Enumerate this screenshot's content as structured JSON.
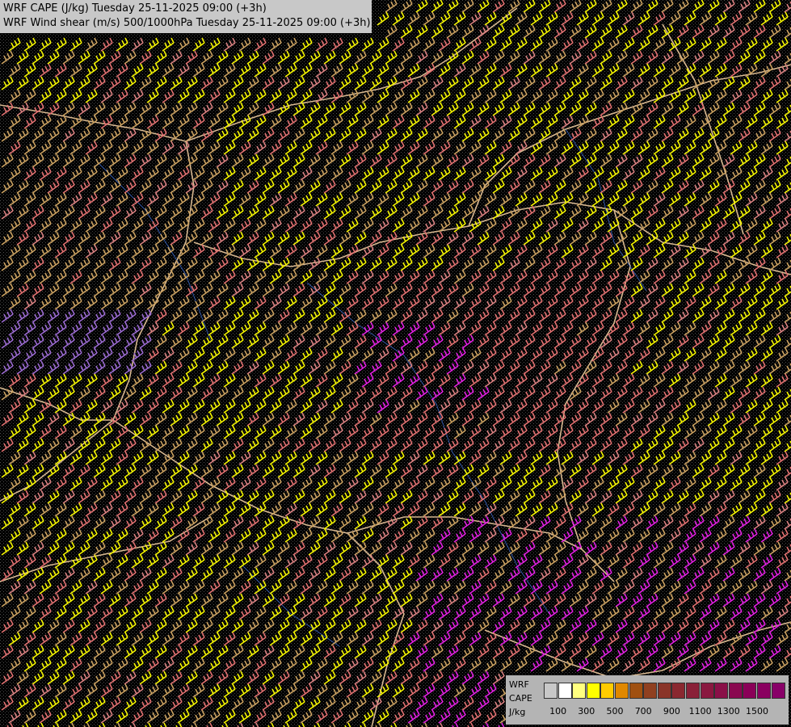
{
  "titles": {
    "line1": "WRF CAPE (J/kg) Tuesday 25-11-2025 09:00 (+3h)",
    "line2": "WRF Wind shear (m/s) 500/1000hPa Tuesday 25-11-2025 09:00 (+3h)"
  },
  "legend": {
    "label_line1": "WRF",
    "label_line2": "CAPE",
    "label_line3": "J/kg",
    "colors": [
      "#c8c8c8",
      "#ffffff",
      "#ffff80",
      "#ffff00",
      "#ffcc00",
      "#e08800",
      "#a05010",
      "#904020",
      "#8a3428",
      "#8a2830",
      "#8a2038",
      "#8a1840",
      "#8a1048",
      "#8a0850",
      "#8a0058",
      "#8a0060",
      "#880068"
    ],
    "ticks": [
      "100",
      "300",
      "500",
      "700",
      "900",
      "1100",
      "1300",
      "1500"
    ]
  },
  "barb_colors": {
    "yellow": "#f4f400",
    "tan": "#c9a060",
    "salmon": "#e07070",
    "magenta": "#e020e0",
    "lavender": "#9a6ad0",
    "pink": "#d88080"
  },
  "map_colors": {
    "background": "#000000",
    "border": "#d8b890",
    "river": "#3a6ad0",
    "stipple": "#606060"
  }
}
